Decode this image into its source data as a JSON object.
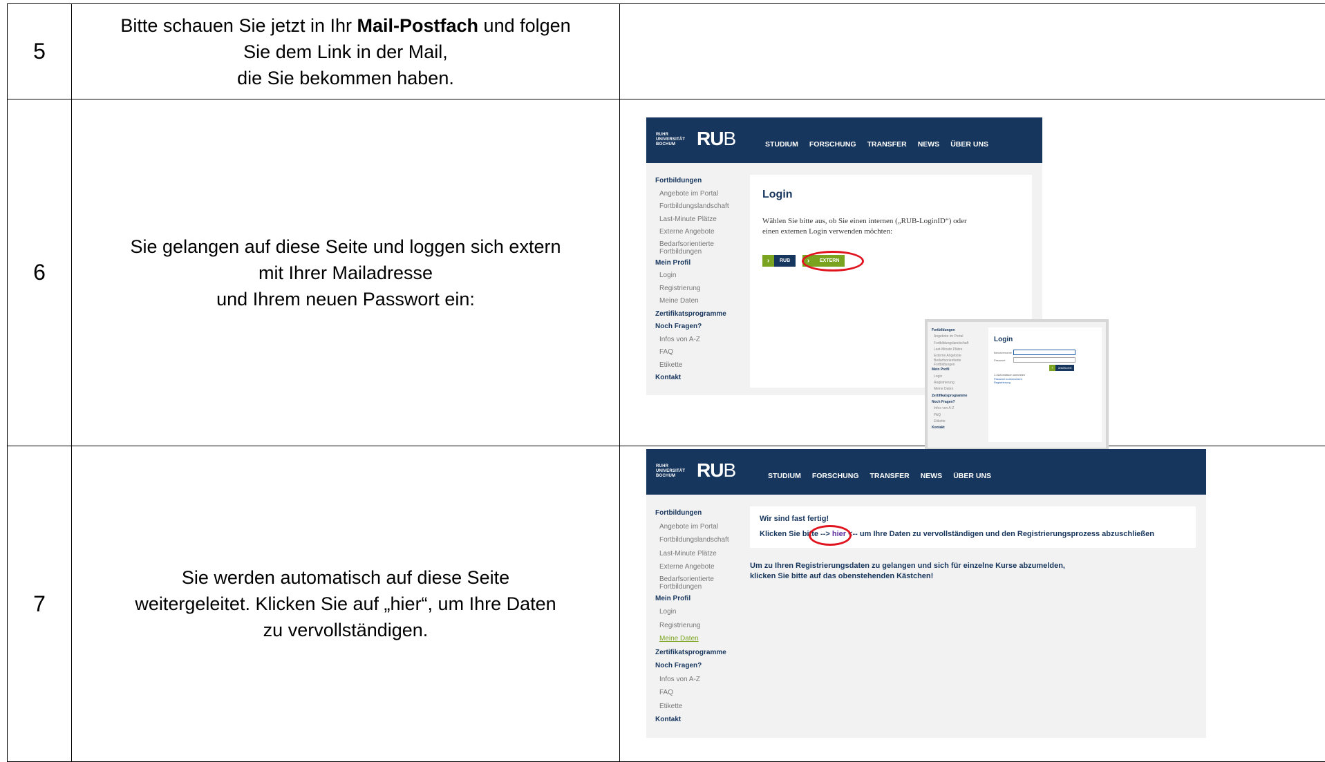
{
  "rows": [
    {
      "number": "5",
      "text_parts": {
        "a": "Bitte schauen Sie jetzt in Ihr ",
        "bold": "Mail-Postfach",
        "b": " und folgen",
        "line2": "Sie dem Link in der Mail,",
        "line3": "die Sie bekommen haben."
      }
    },
    {
      "number": "6",
      "lines": [
        "Sie gelangen auf diese Seite und loggen sich extern",
        "mit Ihrer Mailadresse",
        "und Ihrem neuen Passwort ein:"
      ]
    },
    {
      "number": "7",
      "lines": [
        "Sie werden automatisch auf diese Seite",
        "weitergeleitet. Klicken Sie auf „hier“, um Ihre Daten",
        "zu vervollständigen."
      ]
    }
  ],
  "rub_header": {
    "logo_small": [
      "RUHR",
      "UNIVERSITÄT",
      "BOCHUM"
    ],
    "logo_big_bold": "RU",
    "logo_big_thin": "B",
    "nav": [
      "STUDIUM",
      "FORSCHUNG",
      "TRANSFER",
      "NEWS",
      "ÜBER UNS"
    ]
  },
  "sidebar": {
    "fortbildungen": "Fortbildungen",
    "angebote": "Angebote im Portal",
    "landschaft": "Fortbildungslandschaft",
    "lastminute": "Last-Minute Plätze",
    "extern": "Externe Angebote",
    "bedarf1": "Bedarfsorientierte",
    "bedarf2": "Fortbildungen",
    "profil": "Mein Profil",
    "login": "Login",
    "registrierung": "Registrierung",
    "daten": "Meine Daten",
    "zertifikat": "Zertifikatsprogramme",
    "fragen": "Noch Fragen?",
    "infos": "Infos von A-Z",
    "faq": "FAQ",
    "etikette": "Etikette",
    "kontakt": "Kontakt"
  },
  "login_page": {
    "title": "Login",
    "text_line1": "Wählen Sie bitte aus, ob Sie einen internen („RUB-LoginID“) oder",
    "text_line2": "einen externen Login verwenden möchten:",
    "btn_rub": "RUB",
    "btn_extern": "EXTERN"
  },
  "overlay_login": {
    "title": "Login",
    "label_user": "Benutzername",
    "label_pass": "Passwort",
    "button": "ANMELDEN",
    "checkbox": "Automatisch anmelden",
    "link1": "Passwort zurücksetzen",
    "link2": "Registrierung"
  },
  "fertig_page": {
    "title": "Wir sind fast fertig!",
    "line_pre": "Klicken Sie bitte --> ",
    "link": "hier",
    "line_post": " <-- um Ihre Daten zu vervollständigen und den Registrierungsprozess abzuschließen",
    "info1": "Um zu Ihren Registrierungsdaten zu gelangen und sich für einzelne Kurse abzumelden,",
    "info2": "klicken Sie bitte auf das obenstehenden Kästchen!"
  },
  "colors": {
    "header_bg": "#17365d",
    "accent_green": "#7aa41f",
    "highlight_red": "#e0141e"
  }
}
